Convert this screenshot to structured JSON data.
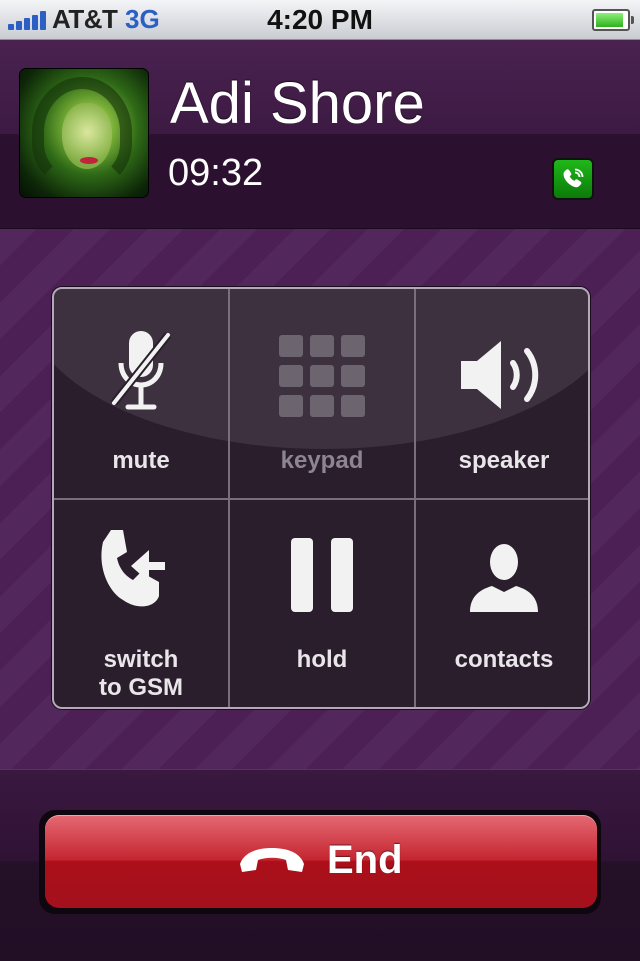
{
  "status_bar": {
    "carrier": "AT&T",
    "network": "3G",
    "time": "4:20 PM",
    "signal_bars": 5,
    "battery_level": 0.9
  },
  "call": {
    "contact_name": "Adi Shore",
    "duration": "09:32",
    "avatar_icon": "contact-photo",
    "badge_icon": "viber-phone-icon"
  },
  "controls": [
    {
      "label": "mute",
      "icon": "mic-off-icon",
      "enabled": true
    },
    {
      "label": "keypad",
      "icon": "keypad-icon",
      "enabled": false
    },
    {
      "label": "speaker",
      "icon": "speaker-icon",
      "enabled": true
    },
    {
      "label_line1": "switch",
      "label_line2": "to GSM",
      "icon": "switch-gsm-icon",
      "enabled": true
    },
    {
      "label": "hold",
      "icon": "pause-icon",
      "enabled": true
    },
    {
      "label": "contacts",
      "icon": "contacts-icon",
      "enabled": true
    }
  ],
  "end_button": {
    "label": "End",
    "icon": "hangup-icon"
  },
  "colors": {
    "end_red": "#c52631",
    "background_purple": "#4c1f55",
    "badge_green": "#1fb81a",
    "network_blue": "#2b5fc4"
  }
}
